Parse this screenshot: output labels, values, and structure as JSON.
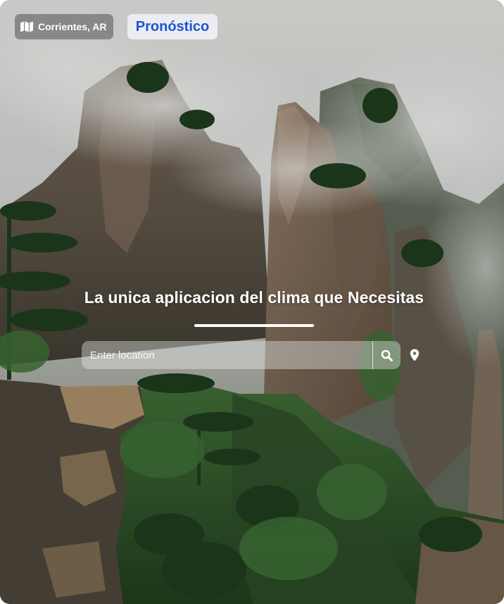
{
  "header": {
    "location_label": "Corrientes, AR",
    "location_icon": "map-icon",
    "forecast_label": "Pronóstico"
  },
  "hero": {
    "title": "La unica aplicacion del clima que Necesitas"
  },
  "search": {
    "placeholder": "Enter location",
    "value": "",
    "search_icon": "search-icon",
    "locate_icon": "map-pin-icon"
  },
  "colors": {
    "accent": "#1d53d6",
    "text": "#ffffff"
  }
}
